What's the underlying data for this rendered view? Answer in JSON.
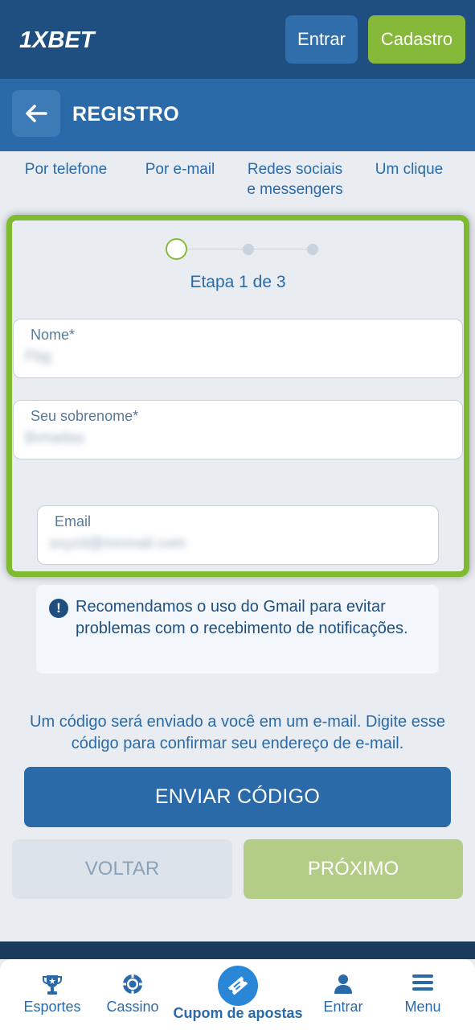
{
  "header": {
    "logo_text": "1XBET",
    "login_label": "Entrar",
    "register_label": "Cadastro"
  },
  "subheader": {
    "title": "REGISTRO"
  },
  "tabs": [
    {
      "label_line1": "Por telefone",
      "label_line2": ""
    },
    {
      "label_line1": "Por e-mail",
      "label_line2": ""
    },
    {
      "label_line1": "Redes sociais",
      "label_line2": "e messengers"
    },
    {
      "label_line1": "Um clique",
      "label_line2": ""
    }
  ],
  "form": {
    "step_label": "Etapa 1 de 3",
    "current_step": 1,
    "total_steps": 3,
    "fields": [
      {
        "label": "Nome*",
        "value": "Fbg"
      },
      {
        "label": "Seu sobrenome*",
        "value": "Bvnadas"
      },
      {
        "label": "Email",
        "value": "sxyzd@mnmail.com"
      }
    ]
  },
  "notice": {
    "icon": "exclamation-icon",
    "text": "Recomendamos o uso do Gmail para evitar problemas com o recebimento de notificações."
  },
  "info_text": "Um código será enviado a você em um e-mail. Digite esse código para confirmar seu endereço de e-mail.",
  "buttons": {
    "send_code": "ENVIAR CÓDIGO",
    "back": "VOLTAR",
    "next": "PRÓXIMO"
  },
  "bottom_nav": [
    {
      "label": "Esportes",
      "icon": "trophy-icon"
    },
    {
      "label": "Cassino",
      "icon": "casino-chip-icon"
    },
    {
      "label": "Cupom de apostas",
      "icon": "ticket-icon"
    },
    {
      "label": "Entrar",
      "icon": "user-icon"
    },
    {
      "label": "Menu",
      "icon": "hamburger-menu-icon"
    }
  ],
  "colors": {
    "header_bg": "#1e4f80",
    "subheader_bg": "#2a6aa8",
    "accent_green": "#86b83a",
    "primary_blue": "#2a6aa8",
    "page_bg": "#e9edf2"
  }
}
